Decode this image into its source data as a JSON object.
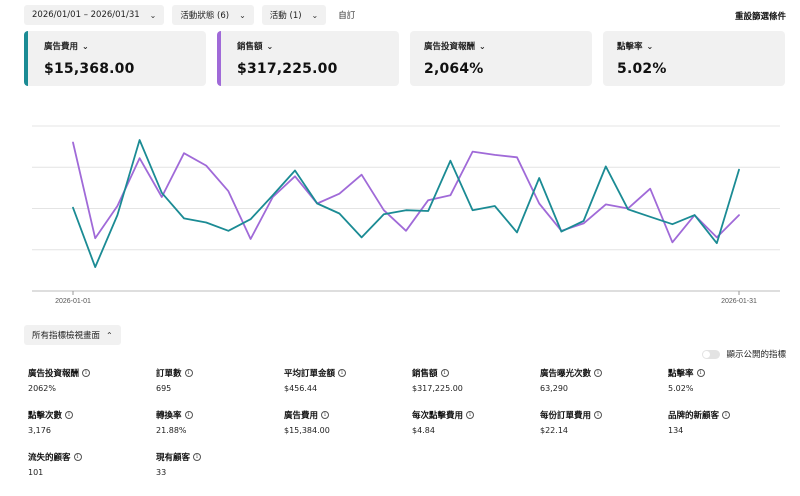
{
  "toolbar": {
    "date_range": "2026/01/01 – 2026/01/31",
    "status_filter": "活動狀態 (6)",
    "campaign_filter": "活動 (1)",
    "custom_label": "自訂",
    "reset_label": "重設篩選條件"
  },
  "cards": [
    {
      "label": "廣告費用",
      "value": "$15,368.00"
    },
    {
      "label": "銷售額",
      "value": "$317,225.00"
    },
    {
      "label": "廣告投資報酬",
      "value": "2,064%"
    },
    {
      "label": "點擊率",
      "value": "5.02%"
    }
  ],
  "chart_data": {
    "type": "line",
    "x_ticks": [
      "2026-01-01",
      "2026-01-31"
    ],
    "y_range": [
      0,
      4
    ],
    "grid": true,
    "colors": {
      "teal": "#1b8b94",
      "purple": "#a06ad8"
    },
    "series": [
      {
        "color": "#1b8b94",
        "values": [
          2.02,
          0.58,
          1.84,
          3.66,
          2.38,
          1.76,
          1.66,
          1.46,
          1.74,
          2.32,
          2.92,
          2.12,
          1.88,
          1.3,
          1.86,
          1.96,
          1.94,
          3.16,
          1.96,
          2.06,
          1.42,
          2.74,
          1.44,
          1.7,
          3.02,
          1.98,
          1.8,
          1.62,
          1.84,
          1.16,
          2.94
        ]
      },
      {
        "color": "#a06ad8",
        "values": [
          3.6,
          1.28,
          2.06,
          3.22,
          2.28,
          3.34,
          3.04,
          2.42,
          1.26,
          2.28,
          2.78,
          2.12,
          2.36,
          2.82,
          1.96,
          1.46,
          2.2,
          2.32,
          3.38,
          3.3,
          3.24,
          2.12,
          1.46,
          1.64,
          2.1,
          2.0,
          2.48,
          1.18,
          1.84,
          1.3,
          1.84
        ]
      }
    ]
  },
  "toggle_label": "所有指標檢視畫面",
  "public_toggle_label": "顯示公開的指標",
  "metrics": [
    {
      "label": "廣告投資報酬",
      "value": "2062%"
    },
    {
      "label": "訂單數",
      "value": "695"
    },
    {
      "label": "平均訂單金額",
      "value": "$456.44"
    },
    {
      "label": "銷售額",
      "value": "$317,225.00"
    },
    {
      "label": "廣告曝光次數",
      "value": "63,290"
    },
    {
      "label": "點擊率",
      "value": "5.02%"
    },
    {
      "label": "點擊次數",
      "value": "3,176"
    },
    {
      "label": "轉換率",
      "value": "21.88%"
    },
    {
      "label": "廣告費用",
      "value": "$15,384.00"
    },
    {
      "label": "每次點擊費用",
      "value": "$4.84"
    },
    {
      "label": "每份訂單費用",
      "value": "$22.14"
    },
    {
      "label": "品牌的新顧客",
      "value": "134"
    },
    {
      "label": "流失的顧客",
      "value": "101"
    },
    {
      "label": "現有顧客",
      "value": "33"
    }
  ]
}
